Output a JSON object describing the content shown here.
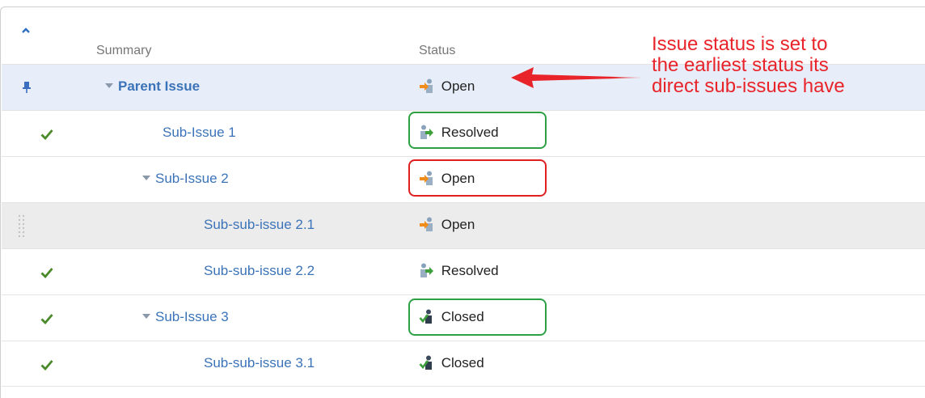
{
  "table": {
    "headers": {
      "summary": "Summary",
      "status": "Status"
    },
    "rows": [
      {
        "summary": "Parent Issue",
        "status": "Open"
      },
      {
        "summary": "Sub-Issue 1",
        "status": "Resolved"
      },
      {
        "summary": "Sub-Issue 2",
        "status": "Open"
      },
      {
        "summary": "Sub-sub-issue 2.1",
        "status": "Open"
      },
      {
        "summary": "Sub-sub-issue 2.2",
        "status": "Resolved"
      },
      {
        "summary": "Sub-Issue 3",
        "status": "Closed"
      },
      {
        "summary": "Sub-sub-issue 3.1",
        "status": "Closed"
      }
    ]
  },
  "annotation": {
    "line1": "Issue status is set to",
    "line2": "the earliest status its",
    "line3": "direct sub-issues have"
  },
  "colors": {
    "link": "#3b73b9",
    "annotation": "#e8242a",
    "highlight_ok": "#2ea043",
    "highlight_bad": "#e02020",
    "parent_row_bg": "#e8eef9",
    "check": "#4a8a2a"
  },
  "icons": {
    "open": "status-open-icon",
    "resolved": "status-resolved-icon",
    "closed": "status-closed-icon",
    "check": "check-icon",
    "pin": "pin-icon",
    "collapse": "collapse-up-icon",
    "expand": "expand-triangle-icon",
    "drag": "drag-handle-icon"
  }
}
